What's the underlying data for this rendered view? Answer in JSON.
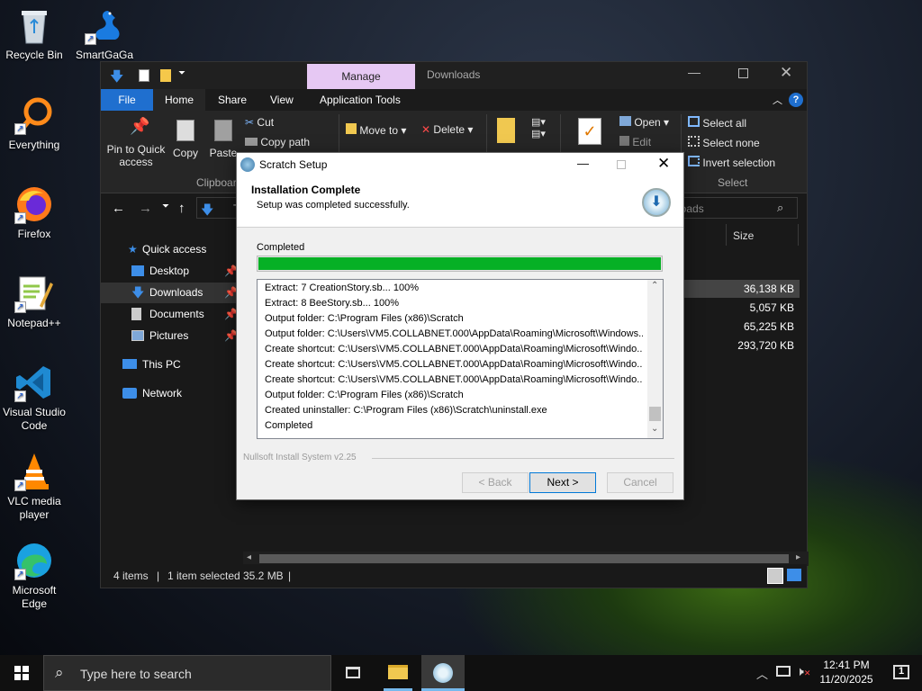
{
  "desktop": {
    "icons": [
      {
        "label": "Recycle Bin",
        "icon": "recycle-bin-icon"
      },
      {
        "label": "SmartGaGa",
        "icon": "swan-icon"
      },
      {
        "label": "Everything",
        "icon": "everything-search-icon"
      },
      {
        "label": "Firefox",
        "icon": "firefox-icon"
      },
      {
        "label": "Notepad++",
        "icon": "notepadpp-icon"
      },
      {
        "label": "Visual Studio Code",
        "icon": "vscode-icon"
      },
      {
        "label": "VLC media player",
        "icon": "vlc-icon"
      },
      {
        "label": "Microsoft Edge",
        "icon": "edge-icon"
      }
    ]
  },
  "explorer": {
    "context_tab": "Manage",
    "window_title": "Downloads",
    "tabs": [
      "File",
      "Home",
      "Share",
      "View",
      "Application Tools"
    ],
    "ribbon": {
      "pin": "Pin to Quick access",
      "copy": "Copy",
      "paste": "Paste",
      "cut": "Cut",
      "copy_path": "Copy path",
      "clipboard_group": "Clipboard",
      "move_to": "Move to",
      "delete": "Delete",
      "new": "New",
      "properties": "Properties",
      "open": "Open",
      "edit": "Edit",
      "select_all": "Select all",
      "select_none": "Select none",
      "invert_selection": "Invert selection",
      "select_group": "Select"
    },
    "address_partial": "T",
    "search_placeholder": "loads",
    "nav": {
      "quick_access": "Quick access",
      "desktop": "Desktop",
      "downloads": "Downloads",
      "documents": "Documents",
      "pictures": "Pictures",
      "this_pc": "This PC",
      "network": "Network"
    },
    "column_size": "Size",
    "sizes": [
      "36,138 KB",
      "5,057 KB",
      "65,225 KB",
      "293,720 KB"
    ],
    "status": {
      "items": "4 items",
      "selected": "1 item selected",
      "selected_size": "35.2 MB"
    }
  },
  "setup": {
    "title": "Scratch Setup",
    "header_title": "Installation Complete",
    "header_subtitle": "Setup was completed successfully.",
    "progress_label": "Completed",
    "progress_value": 1.0,
    "log": [
      "Extract: 7 CreationStory.sb... 100%",
      "Extract: 8 BeeStory.sb... 100%",
      "Output folder: C:\\Program Files (x86)\\Scratch",
      "Output folder: C:\\Users\\VM5.COLLABNET.000\\AppData\\Roaming\\Microsoft\\Windows...",
      "Create shortcut: C:\\Users\\VM5.COLLABNET.000\\AppData\\Roaming\\Microsoft\\Windo...",
      "Create shortcut: C:\\Users\\VM5.COLLABNET.000\\AppData\\Roaming\\Microsoft\\Windo...",
      "Create shortcut: C:\\Users\\VM5.COLLABNET.000\\AppData\\Roaming\\Microsoft\\Windo...",
      "Output folder: C:\\Program Files (x86)\\Scratch",
      "Created uninstaller: C:\\Program Files (x86)\\Scratch\\uninstall.exe",
      "Completed"
    ],
    "branding": "Nullsoft Install System v2.25",
    "back_label": "< Back",
    "next_label": "Next >",
    "cancel_label": "Cancel",
    "colors": {
      "progress": "#06b025"
    }
  },
  "taskbar": {
    "search_placeholder": "Type here to search",
    "time": "12:41 PM",
    "date": "11/20/2025",
    "notification_count": "1"
  }
}
